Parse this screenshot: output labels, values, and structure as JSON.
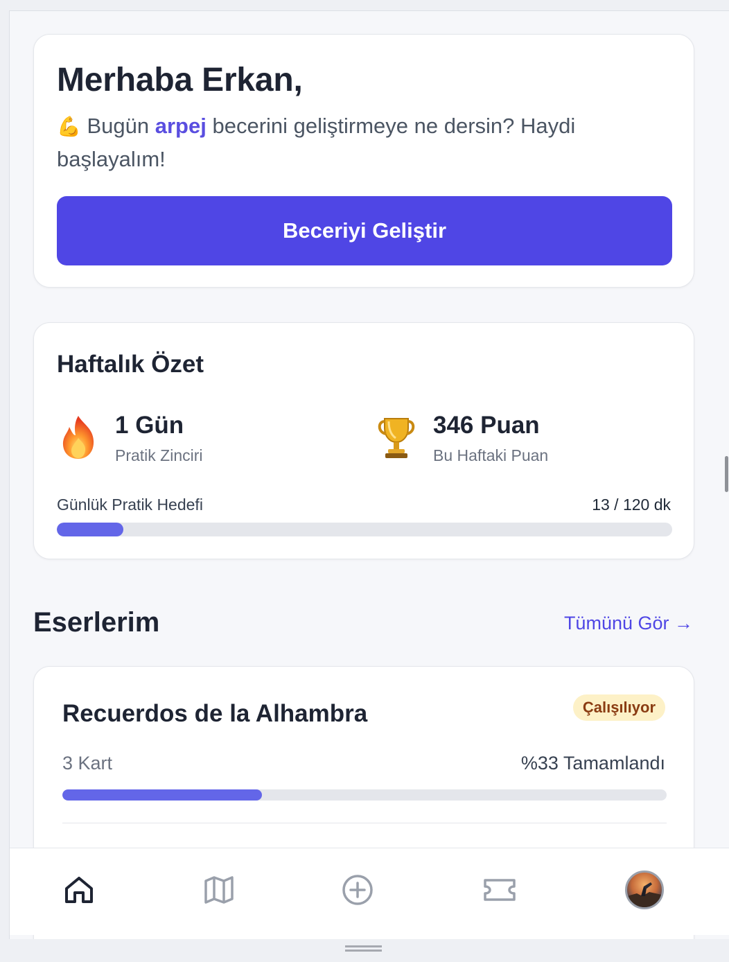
{
  "greeting": {
    "title": "Merhaba Erkan,",
    "emoji": "💪",
    "text_before": " Bugün ",
    "skill": "arpej",
    "text_after": " becerini geliştirmeye ne dersin? Haydi başlayalım!",
    "button_label": "Beceriyi Geliştir"
  },
  "weekly": {
    "title": "Haftalık Özet",
    "streak": {
      "icon": "fire-icon",
      "value": "1 Gün",
      "label": "Pratik Zinciri"
    },
    "points": {
      "icon": "trophy-icon",
      "value": "346 Puan",
      "label": "Bu Haftaki Puan"
    },
    "goal": {
      "label": "Günlük Pratik Hedefi",
      "value_text": "13 / 120 dk",
      "current": 13,
      "target": 120
    }
  },
  "works": {
    "title": "Eserlerim",
    "see_all": "Tümünü Gör →",
    "items": [
      {
        "title": "Recuerdos de la Alhambra",
        "status": "Çalışılıyor",
        "cards": "3 Kart",
        "progress_text": "%33 Tamamlandı",
        "progress": 0.33
      }
    ]
  },
  "nav": {
    "items": [
      {
        "icon": "home-icon",
        "active": true
      },
      {
        "icon": "map-icon",
        "active": false
      },
      {
        "icon": "plus-circle-icon",
        "active": false
      },
      {
        "icon": "ticket-icon",
        "active": false
      },
      {
        "icon": "avatar",
        "active": false
      }
    ]
  },
  "colors": {
    "primary": "#4f46e5",
    "progress": "#6366e8",
    "badge_bg": "#fdf1c7",
    "badge_text": "#8a3c12"
  }
}
